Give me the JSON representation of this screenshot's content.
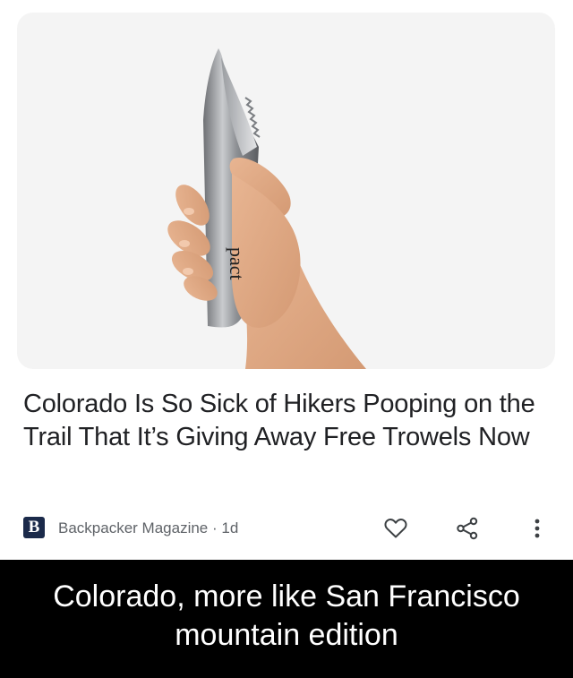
{
  "article": {
    "image_alt": "Hand holding a stainless steel pact trowel",
    "trowel_brand": "pact",
    "headline": "Colorado Is So Sick of Hikers Pooping on the Trail That It’s Giving Away Free Trowels Now",
    "source": {
      "logo_letter": "B",
      "byline": "Backpacker Magazine · 1d"
    },
    "actions": [
      {
        "name": "like",
        "icon": "heart-outline-icon"
      },
      {
        "name": "share",
        "icon": "share-icon"
      },
      {
        "name": "more",
        "icon": "vertical-dots-icon"
      }
    ]
  },
  "caption": {
    "text": "Colorado, more like San Francisco mountain edition"
  },
  "colors": {
    "caption_bg": "#000000",
    "caption_fg": "#ffffff",
    "headline": "#202124",
    "secondary": "#5f6368",
    "image_bg": "#f4f4f4"
  }
}
